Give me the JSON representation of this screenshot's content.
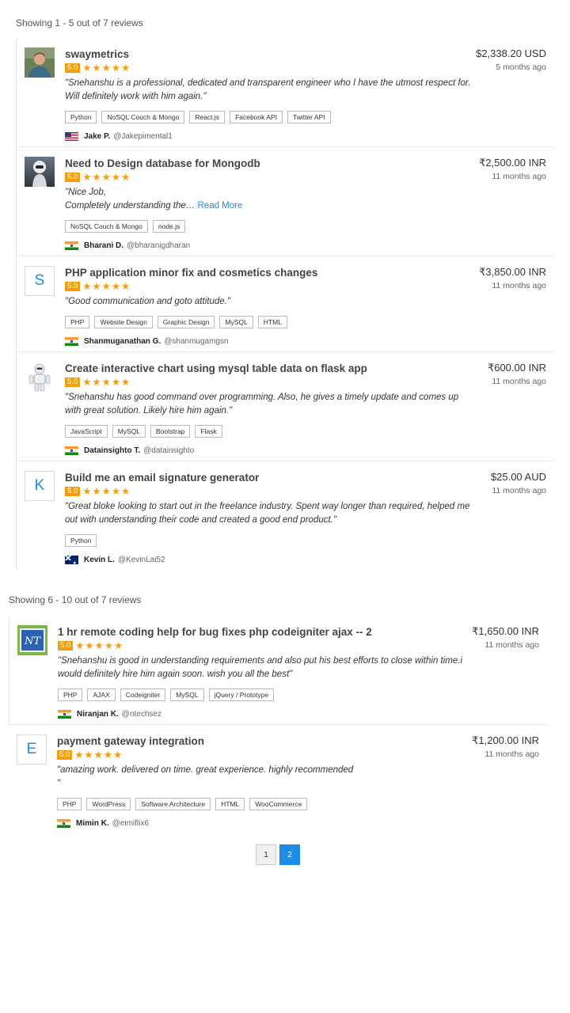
{
  "section1": {
    "showing": "Showing 1 - 5 out of 7 reviews",
    "reviews": [
      {
        "title": "swaymetrics",
        "rating": "5.0",
        "stars": "★★★★★",
        "comment": "\"Snehanshu is a professional, dedicated and transparent engineer who I have the utmost respect for. Will definitely work with him again.\"",
        "tags": [
          "Python",
          "NoSQL Couch & Mongo",
          "React.js",
          "Facebook API",
          "Twitter API"
        ],
        "reviewer_name": "Jake P.",
        "reviewer_handle": "@Jakepimental1",
        "flag": "us",
        "amount": "$2,338.20 USD",
        "ago": "5 months ago"
      },
      {
        "title": "Need to Design database for Mongodb",
        "rating": "5.0",
        "stars": "★★★★★",
        "comment_line1": "\"Nice Job,",
        "comment_line2": "Completely understanding the…",
        "read_more": "Read More",
        "tags": [
          "NoSQL Couch & Mongo",
          "node.js"
        ],
        "reviewer_name": "Bharani D.",
        "reviewer_handle": "@bharanigdharan",
        "flag": "in",
        "amount": "₹2,500.00 INR",
        "ago": "11 months ago"
      },
      {
        "avatar_letter": "S",
        "title": "PHP application minor fix and cosmetics changes",
        "rating": "5.0",
        "stars": "★★★★★",
        "comment": "\"Good communication and goto attitude.\"",
        "tags": [
          "PHP",
          "Website Design",
          "Graphic Design",
          "MySQL",
          "HTML"
        ],
        "reviewer_name": "Shanmuganathan G.",
        "reviewer_handle": "@shanmugamgsn",
        "flag": "in",
        "amount": "₹3,850.00 INR",
        "ago": "11 months ago"
      },
      {
        "title": "Create interactive chart using mysql table data on flask app",
        "rating": "5.0",
        "stars": "★★★★★",
        "comment": "\"Snehanshu has good command over programming. Also, he gives a timely update and comes up with great solution. Likely hire him again.\"",
        "tags": [
          "JavaScript",
          "MySQL",
          "Bootstrap",
          "Flask"
        ],
        "reviewer_name": "Datainsighto T.",
        "reviewer_handle": "@datainsighto",
        "flag": "in",
        "amount": "₹600.00 INR",
        "ago": "11 months ago"
      },
      {
        "avatar_letter": "K",
        "title": "Build me an email signature generator",
        "rating": "5.0",
        "stars": "★★★★★",
        "comment": "\"Great bloke looking to start out in the freelance industry. Spent way longer than required, helped me out with understanding their code and created a good end product.\"",
        "tags": [
          "Python"
        ],
        "reviewer_name": "Kevin L.",
        "reviewer_handle": "@KevinLai52",
        "flag": "au",
        "amount": "$25.00 AUD",
        "ago": "11 months ago"
      }
    ]
  },
  "section2": {
    "showing": "Showing 6 - 10 out of 7 reviews",
    "reviews": [
      {
        "title": "1 hr remote coding help for bug fixes php codeigniter ajax -- 2",
        "rating": "5.0",
        "stars": "★★★★★",
        "comment": "\"Snehanshu is good in understanding requirements and also put his best efforts to close within time.i would definitely hire him again soon. wish you all the best\"",
        "tags": [
          "PHP",
          "AJAX",
          "Codeigniter",
          "MySQL",
          "jQuery / Prototype"
        ],
        "reviewer_name": "Niranjan K.",
        "reviewer_handle": "@ntechsez",
        "flag": "in",
        "amount": "₹1,650.00 INR",
        "ago": "11 months ago"
      },
      {
        "avatar_letter": "E",
        "title": "payment gateway integration",
        "rating": "5.0",
        "stars": "★★★★★",
        "comment_line1": "\"amazing work. delivered on time. great experience. highly recommended",
        "comment_line2": "\"",
        "tags": [
          "PHP",
          "WordPress",
          "Software Architecture",
          "HTML",
          "WooCommerce"
        ],
        "reviewer_name": "Mimin K.",
        "reviewer_handle": "@eimiflix6",
        "flag": "in",
        "amount": "₹1,200.00 INR",
        "ago": "11 months ago"
      }
    ]
  },
  "pagination": {
    "pages": [
      "1",
      "2"
    ],
    "active": "2"
  }
}
